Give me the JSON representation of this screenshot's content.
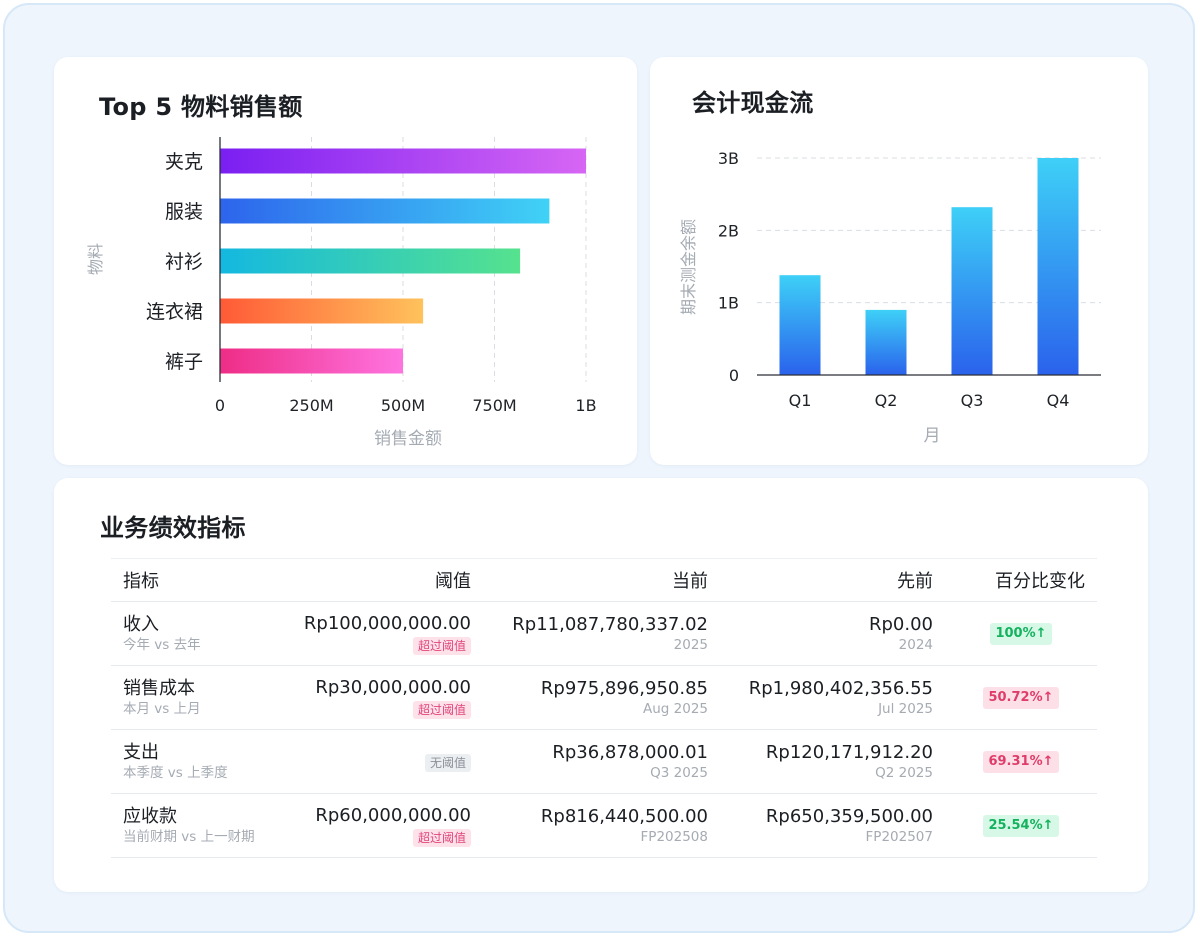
{
  "sales_chart": {
    "title": "Top 5 物料销售额",
    "xlabel": "销售金额",
    "ylabel": "物料",
    "ticks": [
      "0",
      "250M",
      "500M",
      "750M",
      "1B"
    ]
  },
  "cash_chart": {
    "title": "会计现金流",
    "xlabel": "月",
    "ylabel": "期末测金余额",
    "ticks": [
      "0",
      "1B",
      "2B",
      "3B"
    ]
  },
  "chart_data": [
    {
      "type": "bar",
      "orientation": "horizontal",
      "title": "Top 5 物料销售额",
      "xlabel": "销售金额",
      "ylabel": "物料",
      "categories": [
        "夹克",
        "服装",
        "衬衫",
        "连衣裙",
        "裤子"
      ],
      "values": [
        1000000000,
        900000000,
        820000000,
        555000000,
        500000000
      ],
      "xlim": [
        0,
        1000000000
      ],
      "grid": true,
      "colors": [
        [
          "#7a1ff2",
          "#d766f4"
        ],
        [
          "#2d64ec",
          "#40d2f6"
        ],
        [
          "#14b8e0",
          "#56e28e"
        ],
        [
          "#ff5a36",
          "#ffc25c"
        ],
        [
          "#ee2d86",
          "#ff74e0"
        ]
      ]
    },
    {
      "type": "bar",
      "title": "会计现金流",
      "xlabel": "月",
      "ylabel": "期末测金余额",
      "categories": [
        "Q1",
        "Q2",
        "Q3",
        "Q4"
      ],
      "values": [
        1380000000,
        900000000,
        2320000000,
        3000000000
      ],
      "ylim": [
        0,
        3000000000
      ],
      "grid": true,
      "colors": [
        "#3ed0f7",
        "#2a62ec"
      ]
    }
  ],
  "kpi": {
    "title": "业务绩效指标",
    "columns": [
      "指标",
      "阈值",
      "当前",
      "先前",
      "百分比变化"
    ],
    "rows": [
      {
        "name": "收入",
        "period": "今年 vs 去年",
        "threshold": "Rp100,000,000.00",
        "tag": "超过阈值",
        "current": "Rp11,087,780,337.02",
        "current_period": "2025",
        "previous": "Rp0.00",
        "previous_period": "2024",
        "change": "100%↑"
      },
      {
        "name": "销售成本",
        "period": "本月 vs 上月",
        "threshold": "Rp30,000,000.00",
        "tag": "超过阈值",
        "current": "Rp975,896,950.85",
        "current_period": "Aug 2025",
        "previous": "Rp1,980,402,356.55",
        "previous_period": "Jul 2025",
        "change": "50.72%↑"
      },
      {
        "name": "支出",
        "period": "本季度 vs 上季度",
        "threshold": "",
        "tag": "无阈值",
        "current": "Rp36,878,000.01",
        "current_period": "Q3 2025",
        "previous": "Rp120,171,912.20",
        "previous_period": "Q2 2025",
        "change": "69.31%↑"
      },
      {
        "name": "应收款",
        "period": "当前财期 vs 上一财期",
        "threshold": "Rp60,000,000.00",
        "tag": "超过阈值",
        "current": "Rp816,440,500.00",
        "current_period": "FP202508",
        "previous": "Rp650,359,500.00",
        "previous_period": "FP202507",
        "change": "25.54%↑"
      }
    ]
  }
}
